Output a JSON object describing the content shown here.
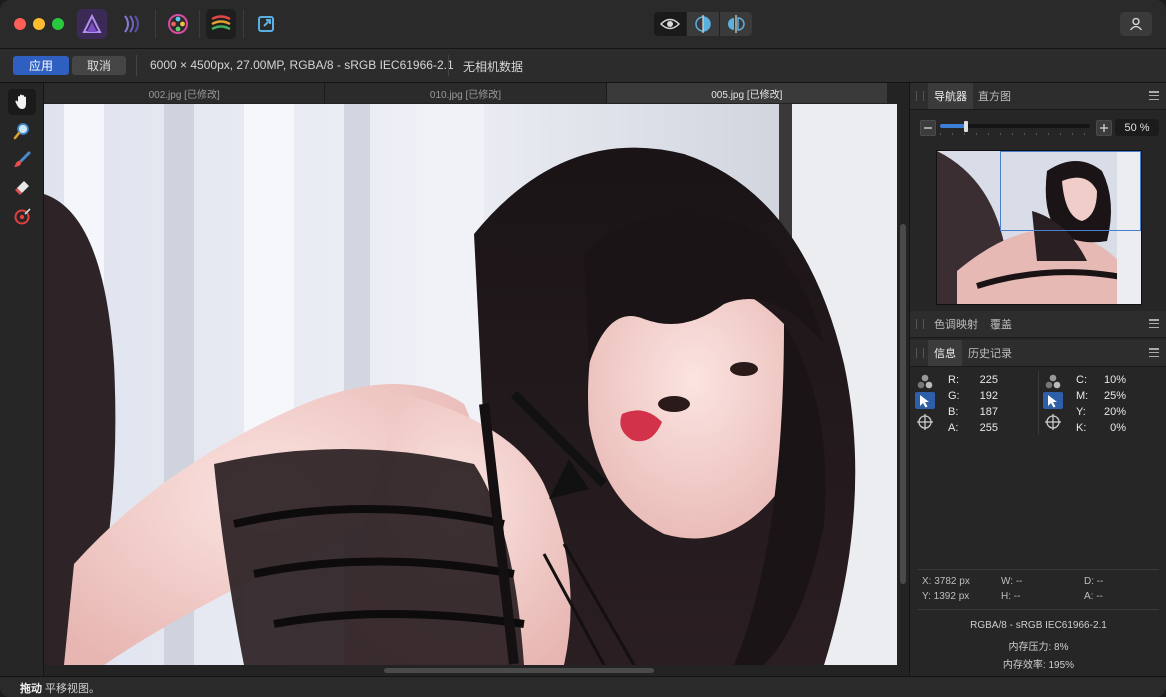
{
  "titlebar": {
    "traffic_lights": {
      "close": "#ff5f57",
      "minimize": "#febc2e",
      "zoom": "#28c840"
    },
    "personas": [
      "photo-persona-icon",
      "liquify-persona-icon",
      "develop-persona-icon",
      "tone-mapping-persona-icon",
      "export-persona-icon"
    ],
    "view_modes": [
      "eye-icon",
      "split-view-icon",
      "mirror-view-icon"
    ],
    "user_icon": "user-icon"
  },
  "context_toolbar": {
    "apply_label": "应用",
    "cancel_label": "取消",
    "image_info": "6000 × 4500px, 27.00MP, RGBA/8 - sRGB IEC61966-2.1",
    "camera_info": "无相机数据"
  },
  "tools": [
    "hand-tool-icon",
    "zoom-tool-icon",
    "brush-tool-icon",
    "eraser-tool-icon",
    "red-eye-tool-icon"
  ],
  "document_tabs": [
    {
      "label": "002.jpg [已修改]",
      "active": false
    },
    {
      "label": "010.jpg [已修改]",
      "active": false
    },
    {
      "label": "005.jpg [已修改]",
      "active": true
    }
  ],
  "navigator_panel": {
    "tab_navigator": "导航器",
    "tab_histogram": "直方图",
    "zoom_value": "50 %",
    "zoom_fraction": 0.17
  },
  "tone_panel": {
    "tab_tone_mapping": "色调映射",
    "tab_overlay": "覆盖"
  },
  "info_panel": {
    "tab_info": "信息",
    "tab_history": "历史记录",
    "rgba": [
      {
        "label": "R:",
        "value": "225"
      },
      {
        "label": "G:",
        "value": "192"
      },
      {
        "label": "B:",
        "value": "187"
      },
      {
        "label": "A:",
        "value": "255"
      }
    ],
    "cmyk": [
      {
        "label": "C:",
        "value": "10%"
      },
      {
        "label": "M:",
        "value": "25%"
      },
      {
        "label": "Y:",
        "value": "20%"
      },
      {
        "label": "K:",
        "value": "0%"
      }
    ],
    "pos_x": "X: 3782 px",
    "pos_y": "Y: 1392 px",
    "w": "W: --",
    "h": "H: --",
    "d": "D: --",
    "a": "A: --",
    "color_profile": "RGBA/8 - sRGB IEC61966-2.1",
    "memory_pressure": "内存压力: 8%",
    "memory_efficiency": "内存效率: 195%"
  },
  "status_bar": {
    "action_bold": "拖动",
    "action_text": "平移视图。"
  }
}
